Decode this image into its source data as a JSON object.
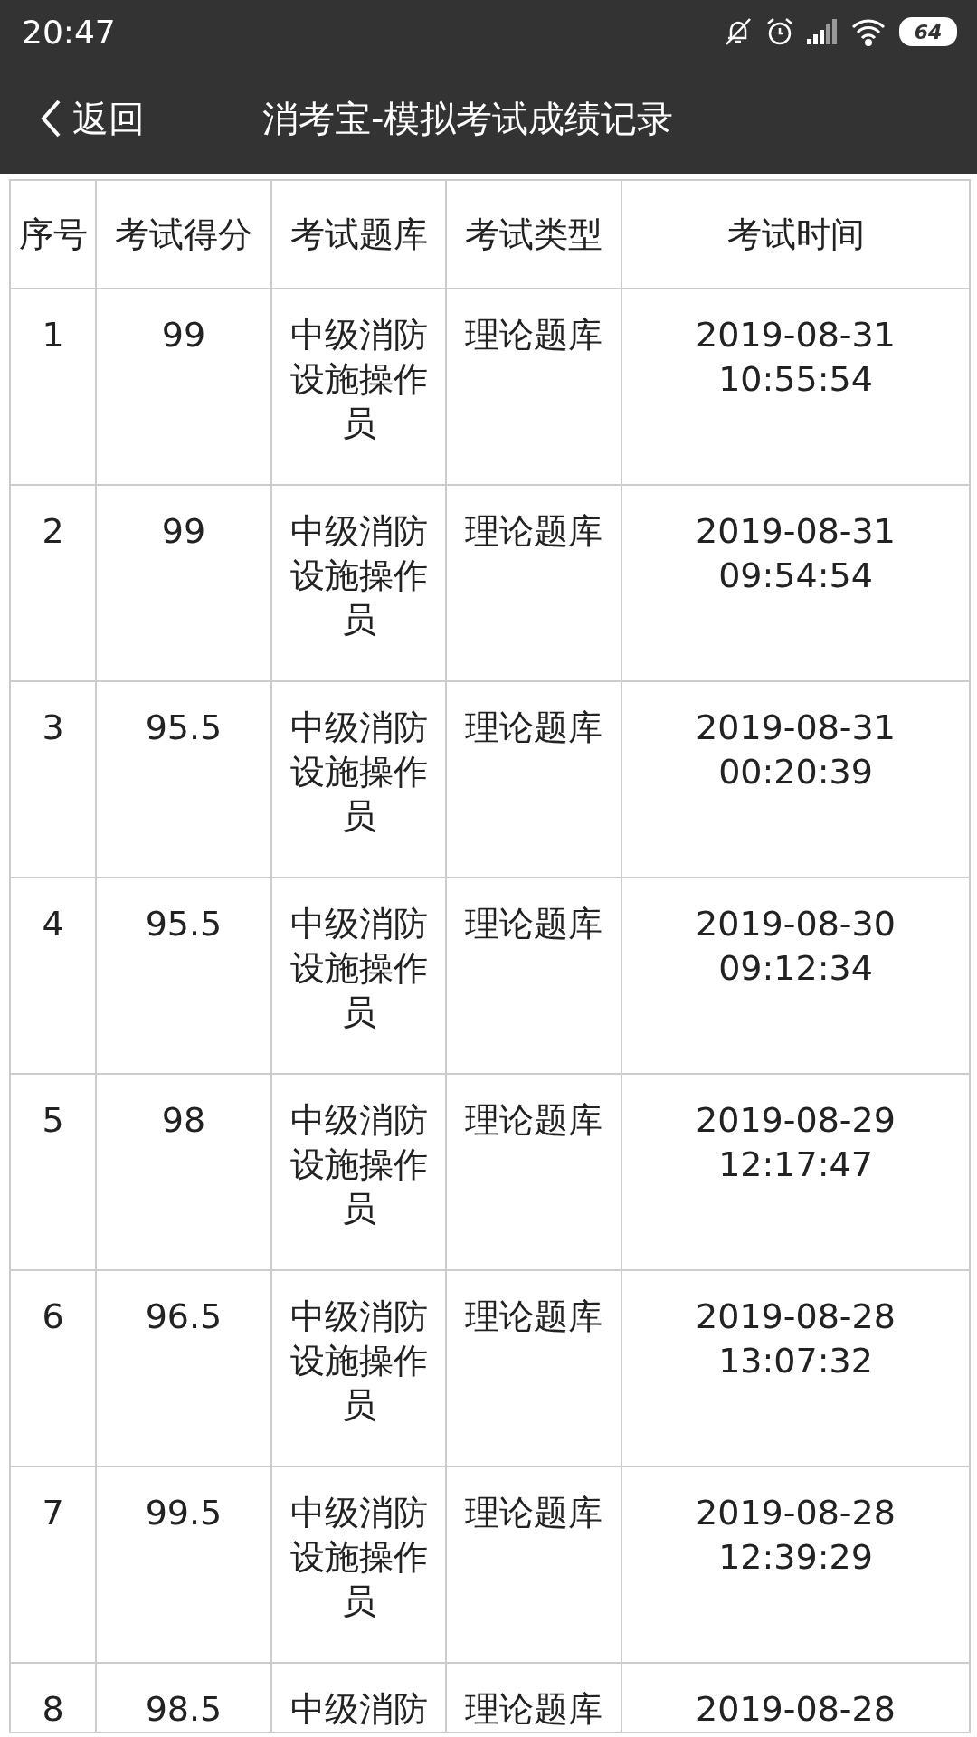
{
  "status_bar": {
    "time": "20:47",
    "battery": "64"
  },
  "nav": {
    "back": "返回",
    "title": "消考宝-模拟考试成绩记录"
  },
  "table": {
    "columns": [
      "序号",
      "考试得分",
      "考试题库",
      "考试类型",
      "考试时间"
    ],
    "rows": [
      {
        "number": "1",
        "score": "99",
        "bank": "中级消防设施操作员",
        "type": "理论题库",
        "time": "2019-08-31 10:55:54"
      },
      {
        "number": "2",
        "score": "99",
        "bank": "中级消防设施操作员",
        "type": "理论题库",
        "time": "2019-08-31 09:54:54"
      },
      {
        "number": "3",
        "score": "95.5",
        "bank": "中级消防设施操作员",
        "type": "理论题库",
        "time": "2019-08-31 00:20:39"
      },
      {
        "number": "4",
        "score": "95.5",
        "bank": "中级消防设施操作员",
        "type": "理论题库",
        "time": "2019-08-30 09:12:34"
      },
      {
        "number": "5",
        "score": "98",
        "bank": "中级消防设施操作员",
        "type": "理论题库",
        "time": "2019-08-29 12:17:47"
      },
      {
        "number": "6",
        "score": "96.5",
        "bank": "中级消防设施操作员",
        "type": "理论题库",
        "time": "2019-08-28 13:07:32"
      },
      {
        "number": "7",
        "score": "99.5",
        "bank": "中级消防设施操作员",
        "type": "理论题库",
        "time": "2019-08-28 12:39:29"
      },
      {
        "number": "8",
        "score": "98.5",
        "bank": "中级消防",
        "type": "理论题库",
        "time": "2019-08-28"
      }
    ]
  }
}
